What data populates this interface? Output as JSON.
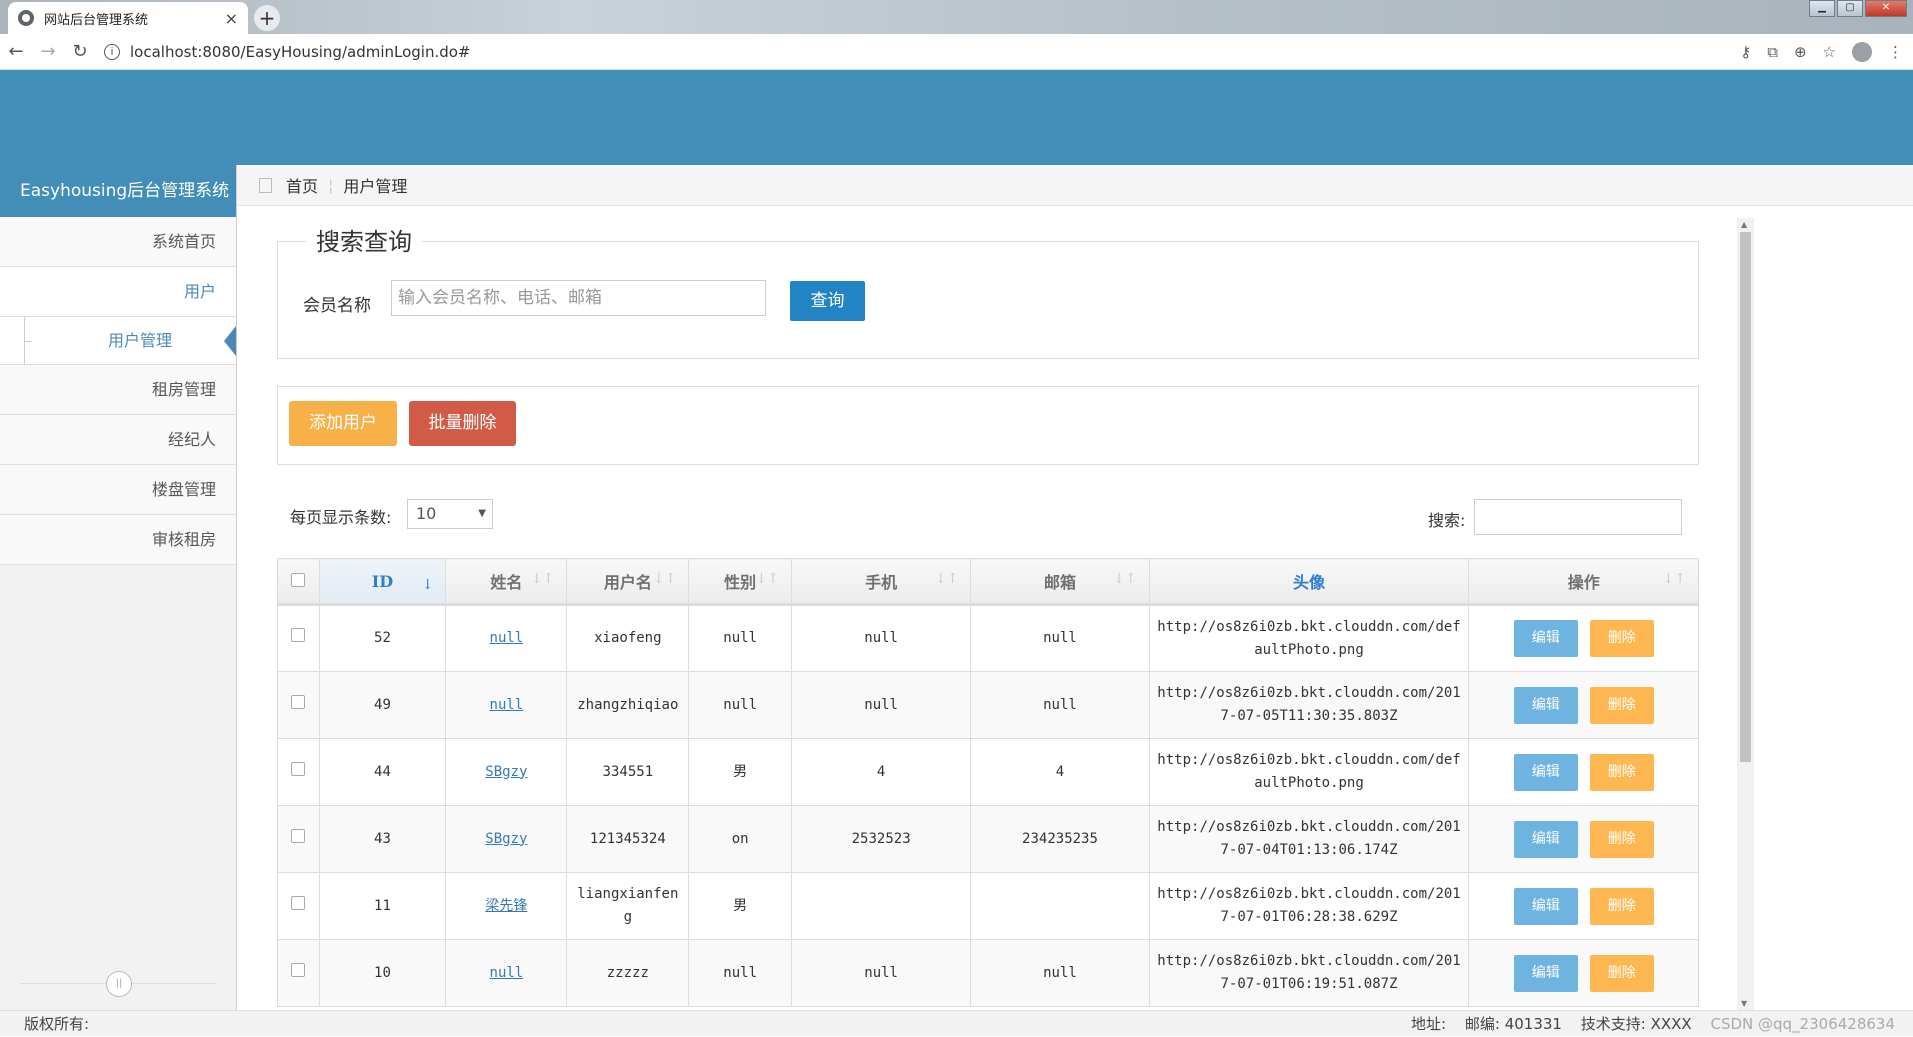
{
  "browser": {
    "tab_title": "网站后台管理系统",
    "tab_close": "×",
    "new_tab": "+",
    "url": "localhost:8080/EasyHousing/adminLogin.do#"
  },
  "sidebar": {
    "brand": "Easyhousing后台管理系统",
    "items": [
      {
        "label": "系统首页"
      },
      {
        "label": "用户"
      },
      {
        "label": "租房管理"
      },
      {
        "label": "经纪人"
      },
      {
        "label": "楼盘管理"
      },
      {
        "label": "审核租房"
      }
    ],
    "sub_item": "用户管理"
  },
  "breadcrumb": {
    "home": "首页",
    "current": "用户管理"
  },
  "search": {
    "legend": "搜索查询",
    "label": "会员名称",
    "placeholder": "输入会员名称、电话、邮箱",
    "button": "查询"
  },
  "toolbar": {
    "add": "添加用户",
    "batch_delete": "批量删除"
  },
  "table_controls": {
    "length_label": "每页显示条数:",
    "length_value": "10",
    "filter_label": "搜索:"
  },
  "table": {
    "columns": [
      "ID",
      "姓名",
      "用户名",
      "性别",
      "手机",
      "邮箱",
      "头像",
      "操作"
    ],
    "edit_label": "编辑",
    "delete_label": "删除",
    "rows": [
      {
        "id": "52",
        "name": "null",
        "username": "xiaofeng",
        "gender": "null",
        "phone": "null",
        "email": "null",
        "avatar": "http://os8z6i0zb.bkt.clouddn.com/defaultPhoto.png"
      },
      {
        "id": "49",
        "name": "null",
        "username": "zhangzhiqiao",
        "gender": "null",
        "phone": "null",
        "email": "null",
        "avatar": "http://os8z6i0zb.bkt.clouddn.com/2017-07-05T11:30:35.803Z"
      },
      {
        "id": "44",
        "name": "SBgzy",
        "username": "334551",
        "gender": "男",
        "phone": "4",
        "email": "4",
        "avatar": "http://os8z6i0zb.bkt.clouddn.com/defaultPhoto.png"
      },
      {
        "id": "43",
        "name": "SBgzy",
        "username": "121345324",
        "gender": "on",
        "phone": "2532523",
        "email": "234235235",
        "avatar": "http://os8z6i0zb.bkt.clouddn.com/2017-07-04T01:13:06.174Z"
      },
      {
        "id": "11",
        "name": "梁先锋",
        "username": "liangxianfeng",
        "gender": "男",
        "phone": "",
        "email": "",
        "avatar": "http://os8z6i0zb.bkt.clouddn.com/2017-07-01T06:28:38.629Z"
      },
      {
        "id": "10",
        "name": "null",
        "username": "zzzzz",
        "gender": "null",
        "phone": "null",
        "email": "null",
        "avatar": "http://os8z6i0zb.bkt.clouddn.com/2017-07-01T06:19:51.087Z"
      }
    ]
  },
  "footer": {
    "copyright": "版权所有:",
    "address": "地址:",
    "postcode": "邮编: 401331",
    "tech": "技术支持: XXXX",
    "watermark": "CSDN @qq_2306428634"
  }
}
